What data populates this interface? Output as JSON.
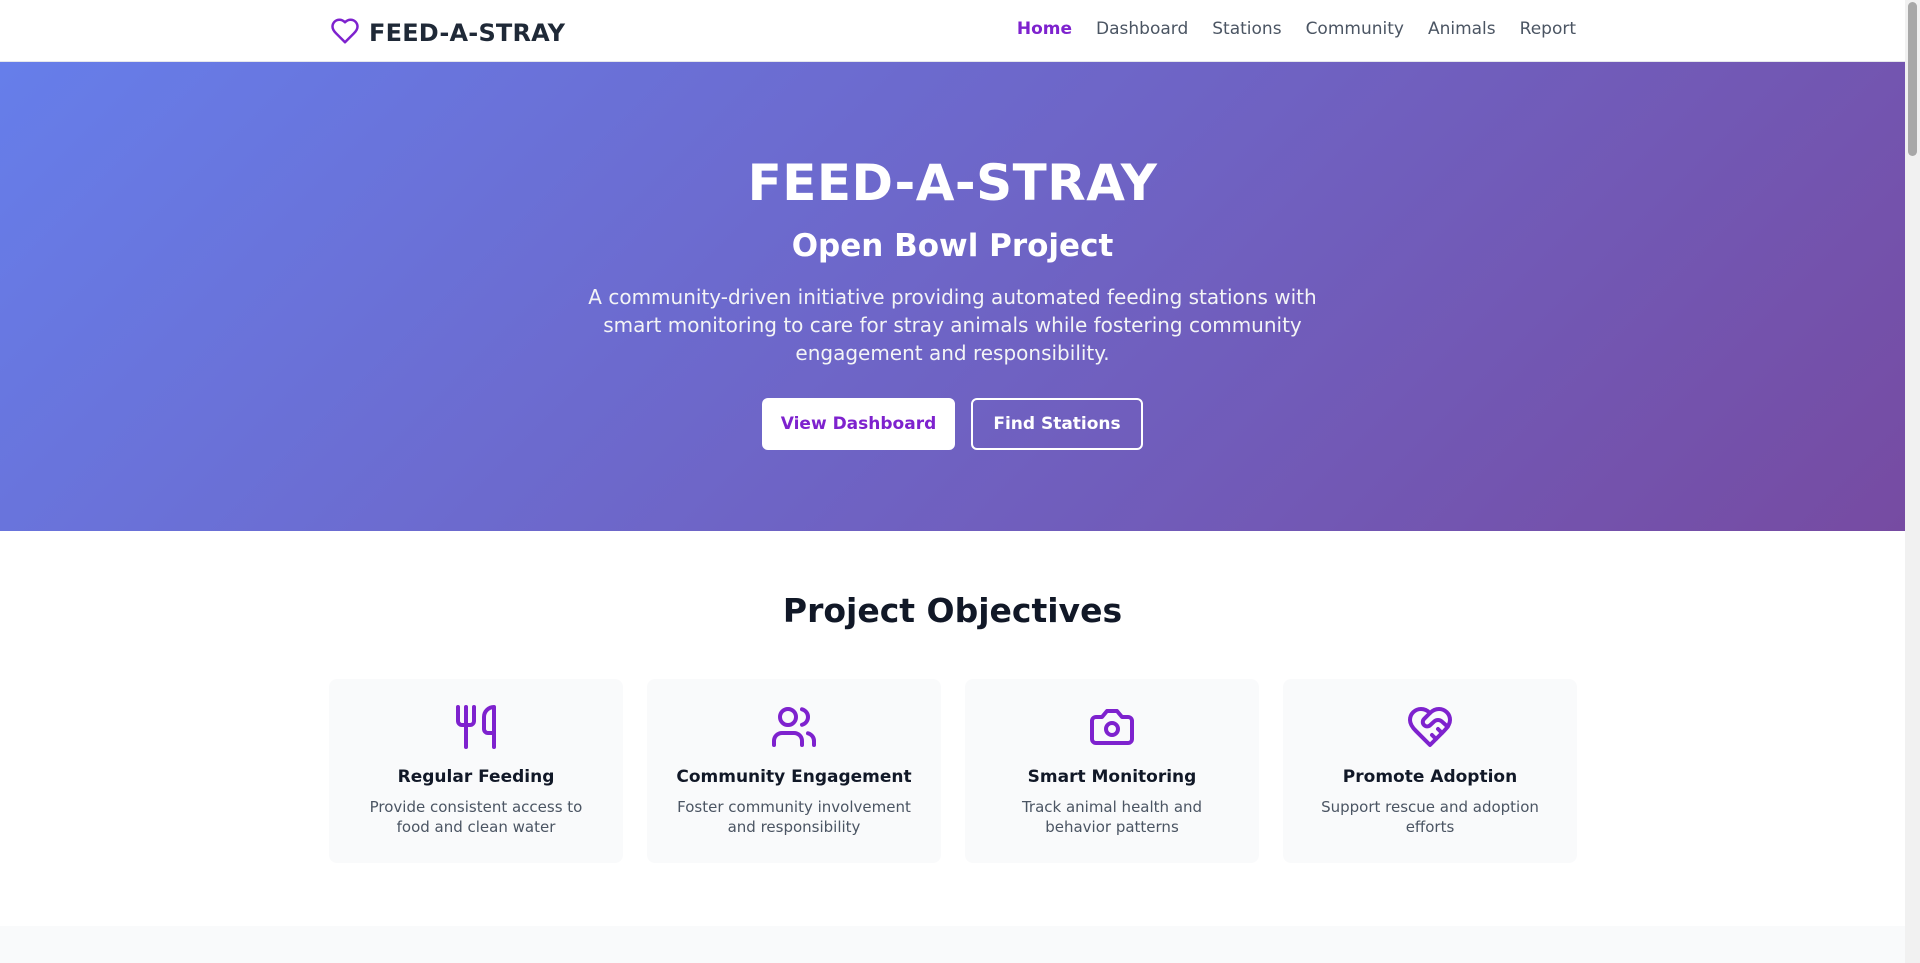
{
  "brand": {
    "name": "FEED-A-STRAY",
    "icon": "heart-icon",
    "accent": "#7e22ce"
  },
  "nav": {
    "items": [
      {
        "label": "Home",
        "active": true
      },
      {
        "label": "Dashboard",
        "active": false
      },
      {
        "label": "Stations",
        "active": false
      },
      {
        "label": "Community",
        "active": false
      },
      {
        "label": "Animals",
        "active": false
      },
      {
        "label": "Report",
        "active": false
      }
    ]
  },
  "hero": {
    "title": "FEED-A-STRAY",
    "subtitle": "Open Bowl Project",
    "description": "A community-driven initiative providing automated feeding stations with smart monitoring to care for stray animals while fostering community engagement and responsibility.",
    "primary_button": "View Dashboard",
    "secondary_button": "Find Stations",
    "gradient_start": "#667eea",
    "gradient_end": "#764ba2"
  },
  "objectives": {
    "title": "Project Objectives",
    "cards": [
      {
        "icon": "utensils-icon",
        "title": "Regular Feeding",
        "description": "Provide consistent access to food and clean water"
      },
      {
        "icon": "users-icon",
        "title": "Community Engagement",
        "description": "Foster community involvement and responsibility"
      },
      {
        "icon": "camera-icon",
        "title": "Smart Monitoring",
        "description": "Track animal health and behavior patterns"
      },
      {
        "icon": "heart-handshake-icon",
        "title": "Promote Adoption",
        "description": "Support rescue and adoption efforts"
      }
    ]
  }
}
